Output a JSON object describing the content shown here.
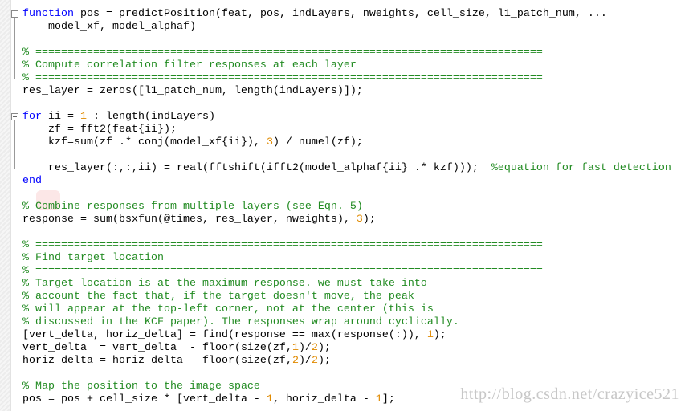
{
  "editor": {
    "lines": [
      [
        [
          "k",
          "function"
        ],
        [
          "t",
          " pos = predictPosition(feat, pos, indLayers, nweights, cell_size, l1_patch_num, ..."
        ]
      ],
      [
        [
          "t",
          "    model_xf, model_alphaf)"
        ]
      ],
      [],
      [
        [
          "c",
          "% ==============================================================================="
        ]
      ],
      [
        [
          "c",
          "% Compute correlation filter responses at each layer"
        ]
      ],
      [
        [
          "c",
          "% ==============================================================================="
        ]
      ],
      [
        [
          "t",
          "res_layer = zeros([l1_patch_num, length(indLayers)]);"
        ]
      ],
      [],
      [
        [
          "k",
          "for"
        ],
        [
          "t",
          " ii = "
        ],
        [
          "n",
          "1"
        ],
        [
          "t",
          " : length(indLayers)"
        ]
      ],
      [
        [
          "t",
          "    zf = fft2(feat{ii});"
        ]
      ],
      [
        [
          "t",
          "    kzf=sum(zf .* conj(model_xf{ii}), "
        ],
        [
          "n",
          "3"
        ],
        [
          "t",
          ") / numel(zf);"
        ]
      ],
      [],
      [
        [
          "t",
          "    res_layer(:,:,ii) = real(fftshift(ifft2(model_alphaf{ii} .* kzf)));  "
        ],
        [
          "c",
          "%equation for fast detection"
        ]
      ],
      [
        [
          "k",
          "end"
        ]
      ],
      [],
      [
        [
          "c",
          "% Combine responses from multiple layers (see Eqn. 5)"
        ]
      ],
      [
        [
          "t",
          "response = sum(bsxfun(@times, res_layer, nweights), "
        ],
        [
          "n",
          "3"
        ],
        [
          "t",
          ");"
        ]
      ],
      [],
      [
        [
          "c",
          "% ==============================================================================="
        ]
      ],
      [
        [
          "c",
          "% Find target location"
        ]
      ],
      [
        [
          "c",
          "% ==============================================================================="
        ]
      ],
      [
        [
          "c",
          "% Target location is at the maximum response. we must take into"
        ]
      ],
      [
        [
          "c",
          "% account the fact that, if the target doesn't move, the peak"
        ]
      ],
      [
        [
          "c",
          "% will appear at the top-left corner, not at the center (this is"
        ]
      ],
      [
        [
          "c",
          "% discussed in the KCF paper). The responses wrap around cyclically."
        ]
      ],
      [
        [
          "t",
          "[vert_delta, horiz_delta] = find(response == max(response(:)), "
        ],
        [
          "n",
          "1"
        ],
        [
          "t",
          ");"
        ]
      ],
      [
        [
          "t",
          "vert_delta  = vert_delta  - floor(size(zf,"
        ],
        [
          "n",
          "1"
        ],
        [
          "t",
          ")/"
        ],
        [
          "n",
          "2"
        ],
        [
          "t",
          ");"
        ]
      ],
      [
        [
          "t",
          "horiz_delta = horiz_delta - floor(size(zf,"
        ],
        [
          "n",
          "2"
        ],
        [
          "t",
          ")/"
        ],
        [
          "n",
          "2"
        ],
        [
          "t",
          ");"
        ]
      ],
      [],
      [
        [
          "c",
          "% Map the position to the image space"
        ]
      ],
      [
        [
          "t",
          "pos = pos + cell_size * [vert_delta - "
        ],
        [
          "n",
          "1"
        ],
        [
          "t",
          ", horiz_delta - "
        ],
        [
          "n",
          "1"
        ],
        [
          "t",
          "];"
        ]
      ]
    ]
  },
  "watermark": "http://blog.csdn.net/crazyice521",
  "colors": {
    "keyword": "#0000ff",
    "comment": "#228b22",
    "number": "#e08a00"
  }
}
